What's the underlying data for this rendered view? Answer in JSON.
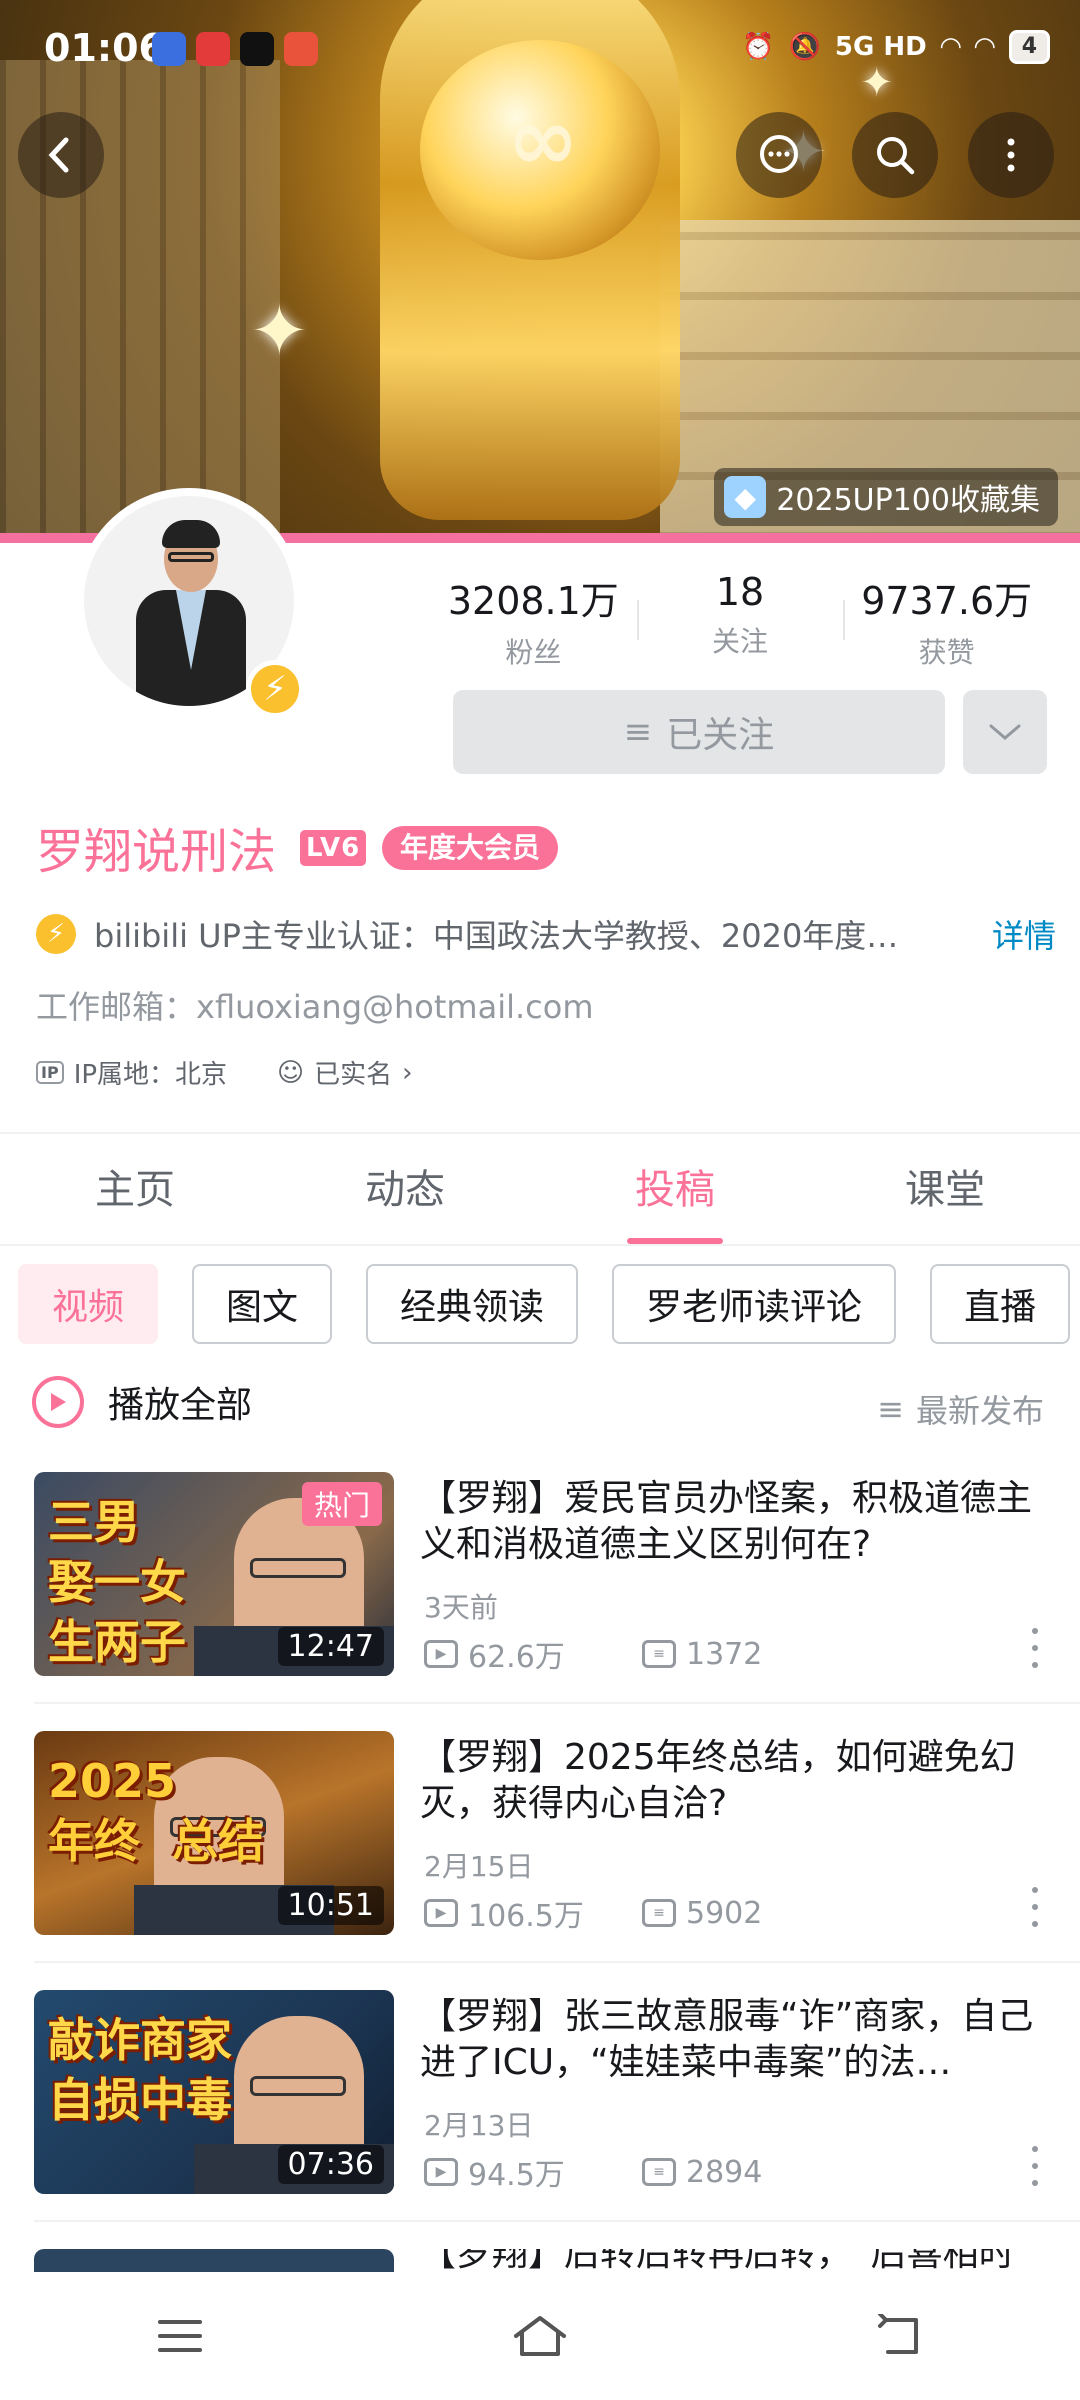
{
  "status_bar": {
    "time": "01:06",
    "network": "5G HD",
    "battery": "4"
  },
  "banner": {
    "collection_label": "2025UP100收藏集"
  },
  "profile": {
    "stats": [
      {
        "value": "3208.1万",
        "label": "粉丝"
      },
      {
        "value": "18",
        "label": "关注"
      },
      {
        "value": "9737.6万",
        "label": "获赞"
      }
    ],
    "follow_label": "已关注",
    "name": "罗翔说刑法",
    "level": "LV6",
    "vip_label": "年度大会员",
    "certification": "bilibili UP主专业认证：中国政法大学教授、2020年度…",
    "detail_link": "详情",
    "email": "工作邮箱：xfluoxiang@hotmail.com",
    "ip_location": "IP属地：北京",
    "real_name": "已实名",
    "ip_badge": "IP"
  },
  "tabs": [
    {
      "label": "主页"
    },
    {
      "label": "动态"
    },
    {
      "label": "投稿"
    },
    {
      "label": "课堂"
    }
  ],
  "chips": [
    {
      "label": "视频"
    },
    {
      "label": "图文"
    },
    {
      "label": "经典领读"
    },
    {
      "label": "罗老师读评论"
    },
    {
      "label": "直播"
    }
  ],
  "list_header": {
    "play_all": "播放全部",
    "sort": "最新发布"
  },
  "videos": [
    {
      "thumb_text": "三男\n娶一女\n生两子",
      "hot": "热门",
      "duration": "12:47",
      "title": "【罗翔】爱民官员办怪案，积极道德主义和消极道德主义区别何在?",
      "date": "3天前",
      "views": "62.6万",
      "comments": "1372"
    },
    {
      "thumb_text": "2025\n年终  总结",
      "hot": "",
      "duration": "10:51",
      "title": "【罗翔】2025年终总结，如何避免幻灭，获得内心自洽?",
      "date": "2月15日",
      "views": "106.5万",
      "comments": "5902"
    },
    {
      "thumb_text": "敲诈商家\n自损中毒",
      "hot": "",
      "duration": "07:36",
      "title": "【罗翔】张三故意服毒“诈”商家，自己进了ICU，“娃娃菜中毒案”的法…",
      "date": "2月13日",
      "views": "94.5万",
      "comments": "2894"
    },
    {
      "thumb_text": "",
      "hot": "",
      "duration": "",
      "title": "【罗翔】后转后转再后转，“后喜相时",
      "date": "",
      "views": "",
      "comments": ""
    }
  ],
  "colors": {
    "accent": "#fb7299",
    "link": "#008ac5",
    "muted": "#9499a0"
  }
}
